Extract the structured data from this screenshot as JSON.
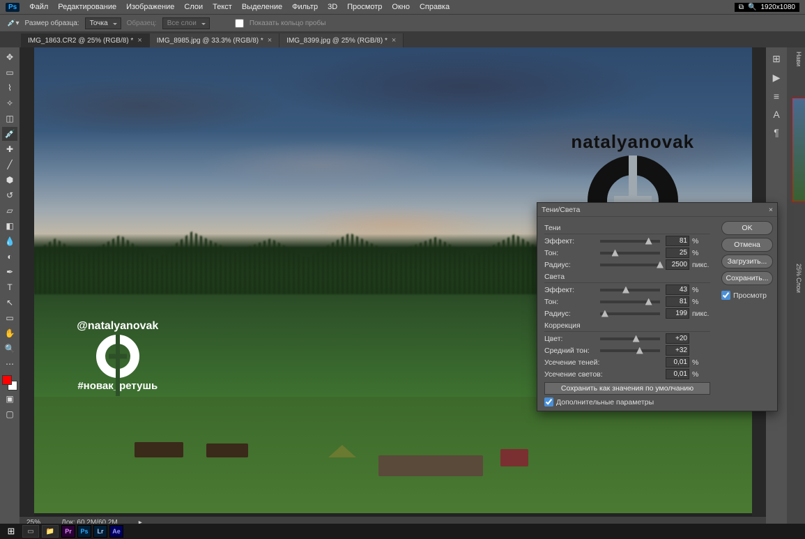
{
  "menu": {
    "items": [
      "Файл",
      "Редактирование",
      "Изображение",
      "Слои",
      "Текст",
      "Выделение",
      "Фильтр",
      "3D",
      "Просмотр",
      "Окно",
      "Справка"
    ]
  },
  "resolution": "1920x1080",
  "optbar": {
    "sample_label": "Размер образца:",
    "sample_value": "Точка",
    "layers_value": "Все слои",
    "checkbox_label": "Показать кольцо пробы",
    "source_label": "Образец:"
  },
  "tabs": [
    {
      "label": "IMG_1863.CR2 @ 25% (RGB/8) *",
      "active": true
    },
    {
      "label": "IMG_8985.jpg @ 33.3% (RGB/8) *",
      "active": false
    },
    {
      "label": "IMG_8399.jpg @ 25% (RGB/8) *",
      "active": false
    }
  ],
  "watermark": {
    "handle": "natalyanovak",
    "hashtag": "#новак",
    "handle2": "@natalyanovak",
    "hashtag2": "#новак_ретушь"
  },
  "status": {
    "zoom": "25%",
    "doc": "Док: 60,2M/60,2M"
  },
  "dialog": {
    "title": "Тени/Света",
    "shadows_title": "Тени",
    "highlights_title": "Света",
    "correction_title": "Коррекция",
    "shadows": {
      "effect_label": "Эффект:",
      "effect": "81",
      "tone_label": "Тон:",
      "tone": "25",
      "radius_label": "Радиус:",
      "radius": "2500",
      "radius_unit": "пикс.",
      "pct": "%"
    },
    "highlights": {
      "effect_label": "Эффект:",
      "effect": "43",
      "tone_label": "Тон:",
      "tone": "81",
      "radius_label": "Радиус:",
      "radius": "199",
      "radius_unit": "пикс.",
      "pct": "%"
    },
    "correction": {
      "color_label": "Цвет:",
      "color": "+20",
      "midtone_label": "Средний тон:",
      "midtone": "+32",
      "clip_shadow_label": "Усечение теней:",
      "clip_shadow": "0,01",
      "clip_hl_label": "Усечение светов:",
      "clip_hl": "0,01",
      "pct": "%"
    },
    "save_defaults": "Сохранить как значения по умолчанию",
    "more_options": "Дополнительные параметры",
    "btn_ok": "OK",
    "btn_cancel": "Отмена",
    "btn_load": "Загрузить...",
    "btn_save": "Сохранить...",
    "preview_label": "Просмотр"
  },
  "rpanel_labels": {
    "nav": "Нави",
    "layers": "Слои",
    "pct": "25%"
  },
  "taskbar_apps": [
    {
      "text": "Pr",
      "bg": "#2a0036",
      "fg": "#e389ff"
    },
    {
      "text": "Ps",
      "bg": "#001e36",
      "fg": "#31a8ff"
    },
    {
      "text": "Lr",
      "bg": "#001e36",
      "fg": "#aad4ff"
    },
    {
      "text": "Ae",
      "bg": "#00005b",
      "fg": "#9999ff"
    }
  ]
}
